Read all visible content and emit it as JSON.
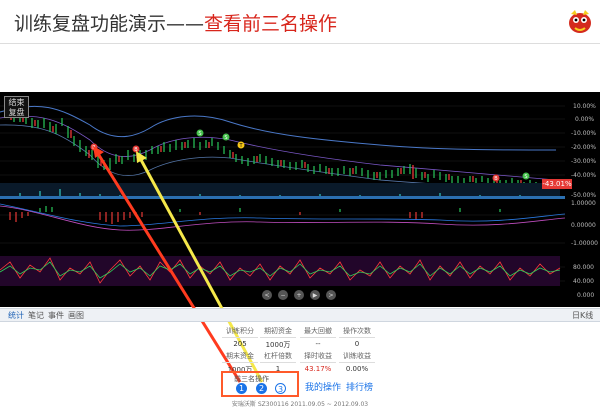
{
  "header": {
    "title_prefix": "训练复盘功能演示——",
    "title_highlight": "查看前三名操作"
  },
  "chart": {
    "end_button": "结束复盘",
    "y_labels_main": [
      "10.00%",
      "0.00%",
      "-10.00%",
      "-20.00%",
      "-30.00%",
      "-40.00%",
      "-50.00%"
    ],
    "current_badge": "-43.01%",
    "y_labels_macd": [
      "1.00000",
      "0.00000",
      "-1.00000"
    ],
    "y_labels_kdj": [
      "80.000",
      "40.000",
      "0.000"
    ]
  },
  "tabs": [
    "统计",
    "笔记",
    "事件",
    "画图"
  ],
  "period_label": "日K线",
  "stats": {
    "row1": [
      {
        "label": "训练积分",
        "value": "205"
      },
      {
        "label": "期初资金",
        "value": "1000万"
      },
      {
        "label": "最大回撤",
        "value": "--"
      },
      {
        "label": "操作次数",
        "value": "0"
      }
    ],
    "row2": [
      {
        "label": "期末资金",
        "value": "1000万"
      },
      {
        "label": "杠杆倍数",
        "value": "1"
      },
      {
        "label": "择时收益",
        "value": "43.17%"
      },
      {
        "label": "训练收益",
        "value": "0.00%"
      }
    ]
  },
  "ops": {
    "label": "前三名操作",
    "items": [
      "1",
      "2",
      "3"
    ]
  },
  "links": {
    "my_ops": "我的操作",
    "ranking": "排行榜"
  },
  "footer": "安瑞沃斯 SZ300116 2011.09.05 ~ 2012.09.03",
  "colors": {
    "title_accent": "#d8261c",
    "arrow_red": "#ff3b1f",
    "arrow_yellow": "#f5e84a",
    "link_blue": "#1a73e8"
  }
}
